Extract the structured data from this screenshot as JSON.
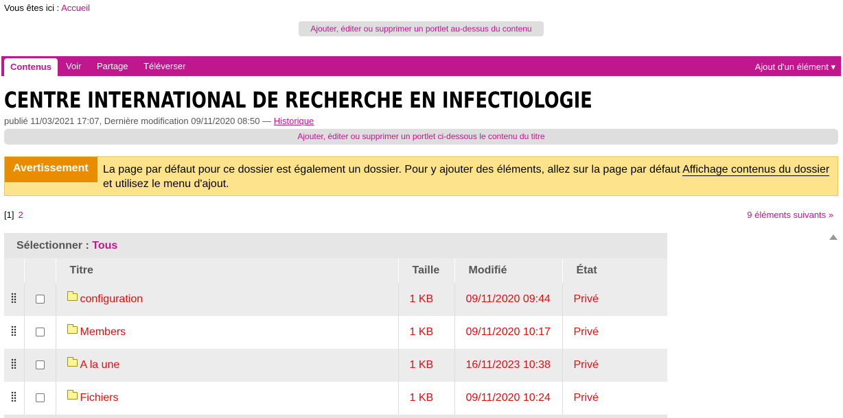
{
  "breadcrumb": {
    "prefix": "Vous êtes ici :",
    "home": "Accueil"
  },
  "portlet_above": "Ajouter, éditer ou supprimer un portlet au-dessus du contenu",
  "edit_bar": {
    "tabs": [
      {
        "label": "Contenus",
        "active": true
      },
      {
        "label": "Voir",
        "active": false
      },
      {
        "label": "Partage",
        "active": false
      },
      {
        "label": "Téléverser",
        "active": false
      }
    ],
    "add_menu": "Ajout d'un élément ▾",
    "color": "#c0168e"
  },
  "title": "CENTRE INTERNATIONAL DE RECHERCHE EN INFECTIOLOGIE",
  "byline": {
    "text": "publié 11/03/2021 17:07, Dernière modification 09/11/2020 08:50 —",
    "history": "Historique"
  },
  "portlet_below_title": "Ajouter, éditer ou supprimer un portlet ci-dessous le contenu du titre",
  "warning": {
    "label": "Avertissement",
    "text_before": "La page par défaut pour ce dossier est également un dossier. Pour y ajouter des éléments, allez sur la page par défaut",
    "link": "Affichage contenus du dossier",
    "text_after": "et utilisez le menu d'ajout."
  },
  "pager": {
    "current": "[1]",
    "next_page": "2",
    "next_link": "9 éléments suivants »"
  },
  "listing": {
    "select_label": "Sélectionner :",
    "select_all": "Tous",
    "columns": [
      "Titre",
      "Taille",
      "Modifié",
      "État"
    ],
    "rows": [
      {
        "title": "configuration",
        "size": "1 KB",
        "modified": "09/11/2020 09:44",
        "state": "Privé"
      },
      {
        "title": "Members",
        "size": "1 KB",
        "modified": "09/11/2020 10:17",
        "state": "Privé"
      },
      {
        "title": "A la une",
        "size": "1 KB",
        "modified": "16/11/2023 10:38",
        "state": "Privé"
      },
      {
        "title": "Fichiers",
        "size": "1 KB",
        "modified": "09/11/2020 10:24",
        "state": "Privé"
      }
    ]
  },
  "icons": {
    "drag_handle": "drag-handle-icon",
    "folder": "folder-icon",
    "scroll": "scroll-up-icon"
  },
  "colors": {
    "accent": "#c0168e",
    "warning_label": "#e98c00",
    "warning_bg": "#fde48c",
    "item_text": "#e01010"
  }
}
